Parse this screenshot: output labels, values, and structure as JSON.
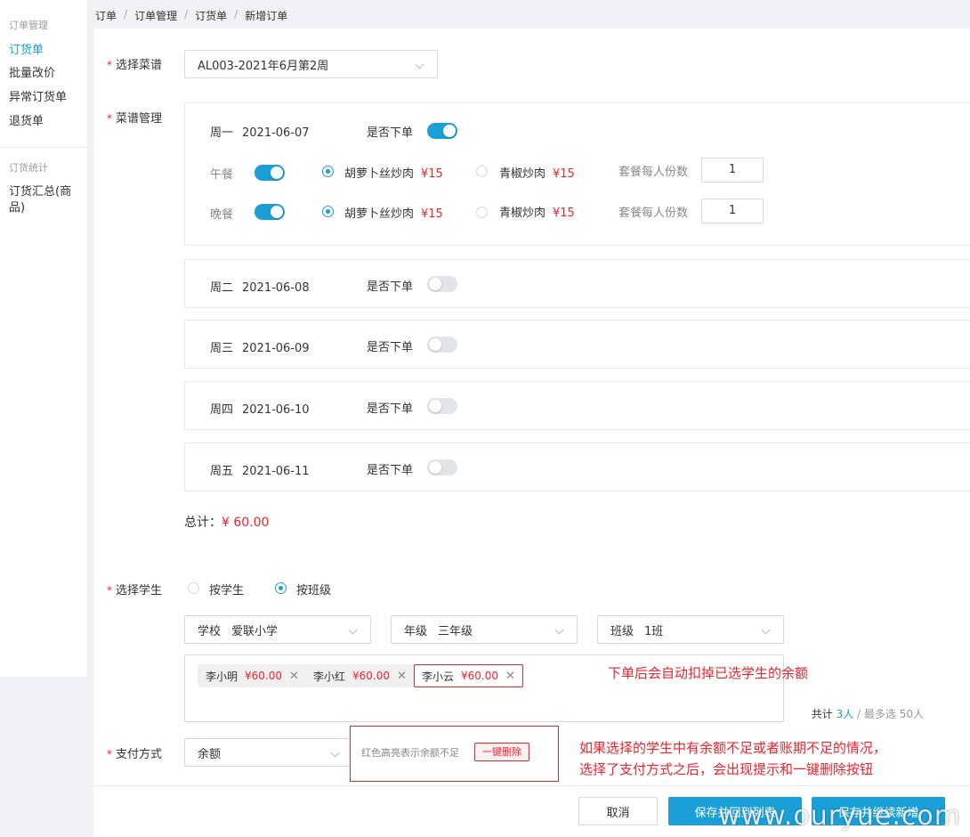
{
  "sidebar": {
    "group1": "订单管理",
    "items1": [
      "订货单",
      "批量改价",
      "异常订货单",
      "退货单"
    ],
    "group2": "订货统计",
    "items2": [
      "订货汇总(商品)"
    ]
  },
  "breadcrumb": [
    "订单",
    "订单管理",
    "订货单",
    "新增订单"
  ],
  "form": {
    "menu_label": "选择菜谱",
    "menu_value": "AL003-2021年6月第2周",
    "menu_mgmt_label": "菜谱管理",
    "student_label": "选择学生",
    "payment_label": "支付方式",
    "payment_value": "余额"
  },
  "days": [
    {
      "weekday": "周一",
      "date": "2021-06-07",
      "order_label": "是否下单",
      "ordered": true,
      "meals": [
        {
          "name": "午餐",
          "on": true,
          "options": [
            {
              "name": "胡萝卜丝炒肉",
              "price": "¥15",
              "selected": true
            },
            {
              "name": "青椒炒肉",
              "price": "¥15",
              "selected": false
            }
          ],
          "portion_label": "套餐每人份数",
          "portion": "1"
        },
        {
          "name": "晚餐",
          "on": true,
          "options": [
            {
              "name": "胡萝卜丝炒肉",
              "price": "¥15",
              "selected": true
            },
            {
              "name": "青椒炒肉",
              "price": "¥15",
              "selected": false
            }
          ],
          "portion_label": "套餐每人份数",
          "portion": "1"
        }
      ]
    },
    {
      "weekday": "周二",
      "date": "2021-06-08",
      "order_label": "是否下单",
      "ordered": false
    },
    {
      "weekday": "周三",
      "date": "2021-06-09",
      "order_label": "是否下单",
      "ordered": false
    },
    {
      "weekday": "周四",
      "date": "2021-06-10",
      "order_label": "是否下单",
      "ordered": false
    },
    {
      "weekday": "周五",
      "date": "2021-06-11",
      "order_label": "是否下单",
      "ordered": false
    }
  ],
  "total": {
    "label": "总计：",
    "value": "¥ 60.00"
  },
  "student_mode": {
    "by_student": "按学生",
    "by_class": "按班级",
    "selected": "by_class"
  },
  "filters": {
    "school": {
      "prefix": "学校",
      "value": "爱联小学"
    },
    "grade": {
      "prefix": "年级",
      "value": "三年级"
    },
    "class": {
      "prefix": "班级",
      "value": "1班"
    }
  },
  "students": [
    {
      "name": "李小明",
      "amount": "¥60.00",
      "insufficient": false
    },
    {
      "name": "李小红",
      "amount": "¥60.00",
      "insufficient": false
    },
    {
      "name": "李小云",
      "amount": "¥60.00",
      "insufficient": true
    }
  ],
  "count": {
    "prefix": "共计",
    "num": "3人",
    "sep": "/",
    "max": "最多选 50人"
  },
  "notes": {
    "deduct": "下单后会自动扣掉已选学生的余额",
    "warn_line1": "如果选择的学生中有余额不足或者账期不足的情况，",
    "warn_line2": "选择了支付方式之后，会出现提示和一键删除按钮"
  },
  "warn_box": {
    "text": "红色高亮表示余额不足",
    "button": "一键删除"
  },
  "footer": {
    "cancel": "取消",
    "save_return": "保存并回到列表",
    "save_new": "保存并继续新增"
  },
  "watermark": "www.ouryue.com",
  "colors": {
    "accent": "#1a9fd6",
    "danger": "#f5222d"
  }
}
